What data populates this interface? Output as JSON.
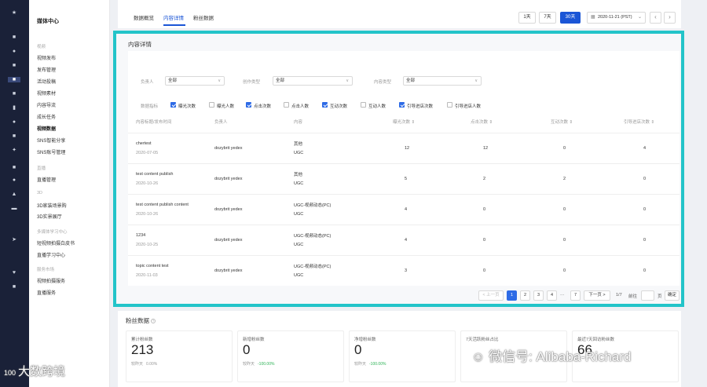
{
  "menu": {
    "title": "媒体中心",
    "groups": [
      {
        "label": "视频",
        "items": [
          "视频发布",
          "发布管理",
          "活动投稿",
          "视频素材",
          "内容导流",
          "成长任务",
          "视频数据",
          "SNS智能分享",
          "SNS账号管理"
        ]
      },
      {
        "label": "直播",
        "items": [
          "直播管理"
        ]
      },
      {
        "label": "3D",
        "items": [
          "3D家装场景购",
          "3D实景展厅"
        ]
      },
      {
        "label": "多媒体学习中心",
        "items": [
          "短视频拍摄白皮书",
          "直播学习中心"
        ]
      },
      {
        "label": "服务市场",
        "items": [
          "视频拍摄服务",
          "直播服务"
        ]
      }
    ]
  },
  "topbar": {
    "tabs": [
      "数据概览",
      "内容详情",
      "粉丝数据"
    ],
    "ranges": [
      "1天",
      "7天",
      "30天"
    ],
    "date": "2020-11-21 (PST)"
  },
  "details": {
    "title": "内容详情",
    "filters": [
      {
        "label": "负责人",
        "value": "全部"
      },
      {
        "label": "创作类型",
        "value": "全部"
      },
      {
        "label": "内容类型",
        "value": "全部"
      }
    ],
    "metrics_label": "数据指标",
    "metrics": [
      {
        "label": "曝光次数",
        "checked": true
      },
      {
        "label": "曝光人数",
        "checked": false
      },
      {
        "label": "点击次数",
        "checked": true
      },
      {
        "label": "点击人数",
        "checked": false
      },
      {
        "label": "互动次数",
        "checked": true
      },
      {
        "label": "互动人数",
        "checked": false
      },
      {
        "label": "引导进店次数",
        "checked": true
      },
      {
        "label": "引导进店人数",
        "checked": false
      }
    ],
    "columns": [
      "内容标题/发布时间",
      "负责人",
      "内容",
      "曝光次数 ⇕",
      "点击次数 ⇕",
      "互动次数 ⇕",
      "引导进店次数 ⇕"
    ],
    "rows": [
      {
        "title": "chertest",
        "date": "2020-07-05",
        "owner": "dozybrit yedex",
        "c1": "其他",
        "c2": "UGC",
        "exp": "12",
        "clk": "12",
        "int": "0",
        "lead": "4"
      },
      {
        "title": "test content publish",
        "date": "2020-10-26",
        "owner": "dozybrit yedex",
        "c1": "其他",
        "c2": "UGC",
        "exp": "5",
        "clk": "2",
        "int": "2",
        "lead": "0"
      },
      {
        "title": "test content publish content",
        "date": "2020-10-26",
        "owner": "dozybrit yedex",
        "c1": "UGC-视频动态(PC)",
        "c2": "UGC",
        "exp": "4",
        "clk": "0",
        "int": "0",
        "lead": "0"
      },
      {
        "title": "1234",
        "date": "2020-10-25",
        "owner": "dozybrit yedex",
        "c1": "UGC-视频动态(PC)",
        "c2": "UGC",
        "exp": "4",
        "clk": "0",
        "int": "0",
        "lead": "0"
      },
      {
        "title": "topic content test",
        "date": "2020-11-03",
        "owner": "dozybrit yedex",
        "c1": "UGC-视频动态(PC)",
        "c2": "UGC",
        "exp": "3",
        "clk": "0",
        "int": "0",
        "lead": "0"
      }
    ],
    "pager": {
      "prev": "< 上一页",
      "pages": [
        "1",
        "2",
        "3",
        "4"
      ],
      "ellipsis": "···",
      "last": "7",
      "next": "下一页 >",
      "total": "1/7",
      "goto": "前往",
      "unit": "页",
      "confirm": "确定"
    }
  },
  "fans": {
    "title": "粉丝数据",
    "help": "?",
    "cards": [
      {
        "label": "累计粉丝数",
        "value": "213",
        "cmp": "较昨天",
        "delta": "0.00%",
        "positive": false
      },
      {
        "label": "新增粉丝数",
        "value": "0",
        "cmp": "较昨天",
        "delta": "-100.00%",
        "positive": true
      },
      {
        "label": "净增粉丝数",
        "value": "0",
        "cmp": "较昨天",
        "delta": "-100.00%",
        "positive": true
      },
      {
        "label": "7天活跃粉丝占比",
        "value": "",
        "cmp": "",
        "delta": "",
        "positive": false
      },
      {
        "label": "最近7天回访粉丝数",
        "value": "66",
        "cmp": "",
        "delta": "",
        "positive": false
      }
    ]
  },
  "watermarks": {
    "right": "微信号: Alibaba-Richard",
    "left": "大数跨境",
    "left_logo": "100"
  }
}
